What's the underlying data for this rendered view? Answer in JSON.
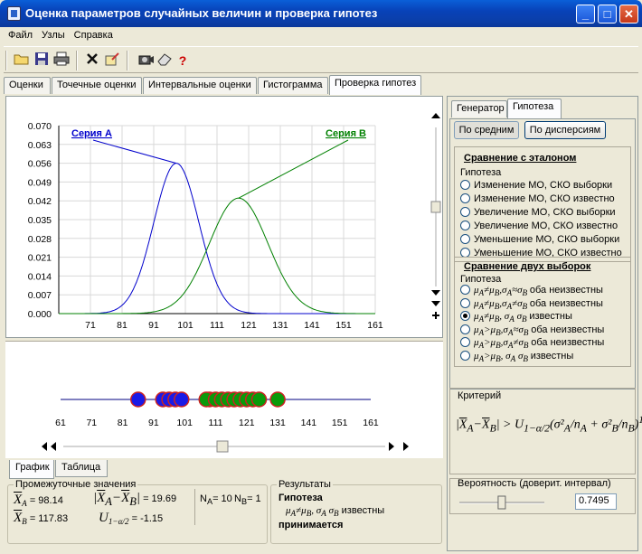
{
  "window": {
    "title": "Оценка параметров случайных величин и проверка гипотез",
    "min_glyph": "_",
    "max_glyph": "□",
    "close_glyph": "✕"
  },
  "menu": [
    "Файл",
    "Узлы",
    "Справка"
  ],
  "toolbar_icons": [
    "open-folder",
    "save",
    "print",
    "delete",
    "edit",
    "camera",
    "eraser",
    "help"
  ],
  "tabs": [
    "Оценки",
    "Точечные оценки",
    "Интервальные оценки",
    "Гистограмма",
    "Проверка гипотез"
  ],
  "active_tab": 4,
  "bottom_tabs": [
    "График",
    "Таблица"
  ],
  "chart_data": {
    "type": "line",
    "y_ticks": [
      "0.070",
      "0.063",
      "0.056",
      "0.049",
      "0.042",
      "0.035",
      "0.028",
      "0.021",
      "0.014",
      "0.007",
      "0.000"
    ],
    "x_ticks": [
      "71",
      "81",
      "91",
      "101",
      "111",
      "121",
      "131",
      "141",
      "151",
      "161"
    ],
    "xlim": [
      61,
      161
    ],
    "ylim": [
      0,
      0.07
    ],
    "grid": true,
    "series": [
      {
        "name": "Серия А",
        "color": "#0000cc",
        "mean": 98.14,
        "peak": 0.056
      },
      {
        "name": "Серия В",
        "color": "#008000",
        "mean": 117.83,
        "peak": 0.043
      }
    ]
  },
  "strip": {
    "x_ticks": [
      "61",
      "71",
      "81",
      "91",
      "101",
      "111",
      "121",
      "131",
      "141",
      "151",
      "161"
    ],
    "series_a_points": [
      86,
      94,
      96,
      98,
      100,
      109
    ],
    "series_b_points": [
      108,
      111,
      113,
      115,
      117,
      119,
      121,
      123,
      125,
      131
    ]
  },
  "stats": {
    "group_label": "Промежуточные значения",
    "xa_label": "X",
    "xa_sub": "A",
    "xa_value": "= 98.14",
    "xb_label": "X",
    "xb_sub": "B",
    "xb_value": "= 117.83",
    "diff_value": "= 19.69",
    "u_label": "U",
    "u_sub": "1−α/2",
    "u_value": "= -1.15",
    "na": "N",
    "na_sub": "A",
    "na_value": "= 10",
    "nb": "N",
    "nb_sub": "B",
    "nb_value": "= 1"
  },
  "results": {
    "group_label": "Результаты",
    "heading": "Гипотеза",
    "formula_tail": "известны",
    "verdict": "принимается"
  },
  "right": {
    "tabs": [
      "Генератор",
      "Гипотеза"
    ],
    "active_tab": 1,
    "subtabs": [
      "По средним",
      "По дисперсиям"
    ],
    "section1_title": "Сравнение с эталоном",
    "section1_group": "Гипотеза",
    "section1_options": [
      "Изменение МО, СКО выборки",
      "Изменение МО, СКО известно",
      "Увеличение МО, СКО выборки",
      "Увеличение МО, СКО известно",
      "Уменьшение МО, СКО выборки",
      "Уменьшение МО, СКО известно"
    ],
    "section2_title": "Сравнение двух выборок",
    "section2_group": "Гипотеза",
    "section2_options": [
      "оба неизвестны",
      "оба неизвестны",
      "известны",
      "оба неизвестны",
      "оба неизвестны",
      "известны"
    ],
    "section2_selected": 2,
    "criterion_label": "Критерий",
    "probability_label": "Вероятность (доверит. интервал)",
    "probability_value": "0.7495",
    "probability_level": 0.7495
  }
}
